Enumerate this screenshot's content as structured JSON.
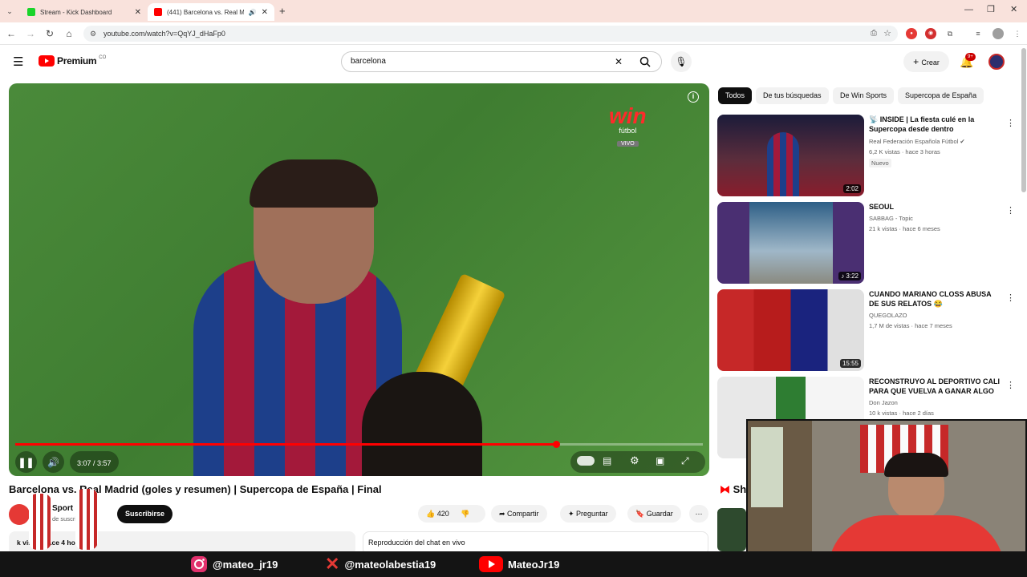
{
  "browser": {
    "tabs": [
      {
        "title": "Stream - Kick Dashboard",
        "close": "✕"
      },
      {
        "title": "(441) Barcelona vs. Real Ma",
        "close": "✕"
      }
    ],
    "new_tab": "+",
    "url": "youtube.com/watch?v=QqYJ_dHaFp0"
  },
  "youtube": {
    "logo_text": "Premium",
    "country_badge": "CO",
    "search_value": "barcelona",
    "create_label": "Crear",
    "notif_count": "9+"
  },
  "player": {
    "current_time": "3:07",
    "duration": "3:57",
    "time_display": "3:07 / 3:57",
    "progress_fraction": 0.786,
    "overlay_brand": "win",
    "overlay_sub": "fútbol",
    "overlay_vivo": "VIVO"
  },
  "video": {
    "title": "Barcelona vs. Real Madrid (goles y resumen) | Supercopa de España | Final",
    "channel_partial": "Sport",
    "subs_partial": "de suscrip",
    "subscribe": "Suscribirse",
    "likes": "420",
    "share": "Compartir",
    "ask": "Preguntar",
    "save": "Guardar",
    "desc_partial": "k vistas  hace 4 ho",
    "chat_label": "Reproducción del chat en vivo"
  },
  "chips": [
    {
      "label": "Todos",
      "selected": true
    },
    {
      "label": "De tus búsquedas",
      "selected": false
    },
    {
      "label": "De Win Sports",
      "selected": false
    },
    {
      "label": "Supercopa de España",
      "selected": false
    }
  ],
  "recommendations": [
    {
      "title": "INSIDE | La fiesta culé en la Supercopa desde dentro",
      "channel": "Real Federación Española Fútbol",
      "stats": "6,2 K vistas · hace 3 horas",
      "badge": "Nuevo",
      "duration": "2:02"
    },
    {
      "title": "SEOUL",
      "channel": "SABBAG - Topic",
      "stats": "21 k vistas · hace 6 meses",
      "badge": "",
      "duration": "3:22"
    },
    {
      "title": "CUANDO MARIANO CLOSS ABUSA DE SUS RELATOS 😂",
      "channel": "QUEGOLAZO",
      "stats": "1,7 M de vistas · hace 7 meses",
      "badge": "",
      "duration": "15:55"
    },
    {
      "title": "RECONSTRUYO AL DEPORTIVO CALI PARA QUE VUELVA A GANAR ALGO",
      "channel": "Don Jazon",
      "stats": "10 k vistas · hace 2 días",
      "badge": "",
      "duration": ""
    }
  ],
  "shorts_partial": "Sh",
  "socials": [
    {
      "icon": "instagram-icon",
      "handle": "@mateo_jr19"
    },
    {
      "icon": "x-icon",
      "handle": "@mateolabestia19"
    },
    {
      "icon": "youtube-icon",
      "handle": "MateoJr19"
    }
  ],
  "colors": {
    "youtube_red": "#ff0000",
    "progress_red": "#f00",
    "brand_green": "#3f7d31"
  }
}
